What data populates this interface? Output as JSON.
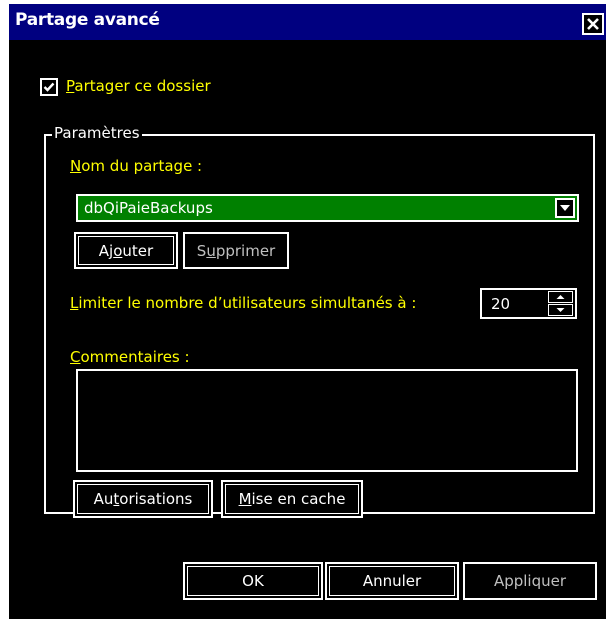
{
  "window": {
    "title": "Partage avancé",
    "close_icon": "close-icon"
  },
  "share": {
    "checkbox_label_accel": "P",
    "checkbox_label_rest": "artager ce dossier",
    "checked": true
  },
  "parameters": {
    "legend": "Paramètres",
    "share_name_label_accel": "N",
    "share_name_label_rest": "om du partage :",
    "share_name_value": "dbQiPaieBackups",
    "add_button_pre": "Aj",
    "add_button_accel": "o",
    "add_button_post": "uter",
    "remove_button_pre": "S",
    "remove_button_accel": "u",
    "remove_button_post": "pprimer",
    "limit_label_accel": "L",
    "limit_label_rest": "imiter le nombre d’utilisateurs simultanés à :",
    "limit_value": "20",
    "comments_label_accel": "C",
    "comments_label_rest": "ommentaires :",
    "comments_value": "",
    "permissions_button_pre": "Au",
    "permissions_button_accel": "t",
    "permissions_button_post": "orisations",
    "caching_button_accel": "M",
    "caching_button_rest": "ise en cache"
  },
  "footer": {
    "ok_label": "OK",
    "cancel_label": "Annuler",
    "apply_label": "Appliquer"
  },
  "colors": {
    "background": "#000000",
    "titlebar": "#000080",
    "label_text": "#ffff00",
    "selection": "#008000",
    "border": "#ffffff"
  }
}
